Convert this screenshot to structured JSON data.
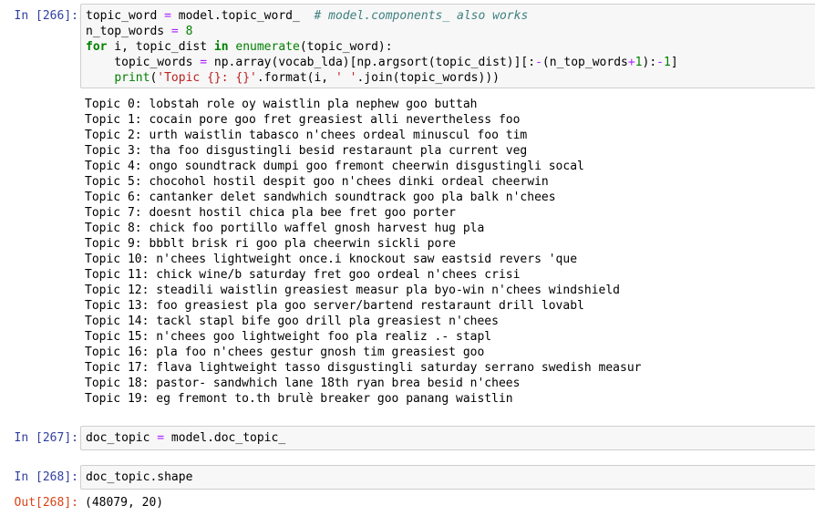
{
  "cells": [
    {
      "prompt": "In [266]:",
      "code_lines": [
        [
          {
            "t": "topic_word "
          },
          {
            "t": "=",
            "c": "op"
          },
          {
            "t": " model.topic_word_  "
          },
          {
            "t": "# model.components_ also works",
            "c": "cm"
          }
        ],
        [
          {
            "t": "n_top_words "
          },
          {
            "t": "=",
            "c": "op"
          },
          {
            "t": " "
          },
          {
            "t": "8",
            "c": "num"
          }
        ],
        [
          {
            "t": "for",
            "c": "kw"
          },
          {
            "t": " i, topic_dist "
          },
          {
            "t": "in",
            "c": "kw"
          },
          {
            "t": " "
          },
          {
            "t": "enumerate",
            "c": "bi"
          },
          {
            "t": "(topic_word):"
          }
        ],
        [
          {
            "t": "    topic_words "
          },
          {
            "t": "=",
            "c": "op"
          },
          {
            "t": " np.array(vocab_lda)[np.argsort(topic_dist)][:"
          },
          {
            "t": "-",
            "c": "op"
          },
          {
            "t": "(n_top_words"
          },
          {
            "t": "+",
            "c": "op"
          },
          {
            "t": "1",
            "c": "num"
          },
          {
            "t": "):"
          },
          {
            "t": "-",
            "c": "op"
          },
          {
            "t": "1",
            "c": "num"
          },
          {
            "t": "]"
          }
        ],
        [
          {
            "t": "    "
          },
          {
            "t": "print",
            "c": "bi"
          },
          {
            "t": "("
          },
          {
            "t": "'Topic {}: {}'",
            "c": "str"
          },
          {
            "t": ".format(i, "
          },
          {
            "t": "' '",
            "c": "str"
          },
          {
            "t": ".join(topic_words)))"
          }
        ]
      ],
      "output_lines": [
        "Topic 0: lobstah role oy waistlin pla nephew goo buttah",
        "Topic 1: cocain pore goo fret greasiest alli nevertheless foo",
        "Topic 2: urth waistlin tabasco n'chees ordeal minuscul foo tim",
        "Topic 3: tha foo disgustingli besid restaraunt pla current veg",
        "Topic 4: ongo soundtrack dumpi goo fremont cheerwin disgustingli socal",
        "Topic 5: chocohol hostil despit goo n'chees dinki ordeal cheerwin",
        "Topic 6: cantanker delet sandwhich soundtrack goo pla balk n'chees",
        "Topic 7: doesnt hostil chica pla bee fret goo porter",
        "Topic 8: chick foo portillo waffel gnosh harvest hug pla",
        "Topic 9: bbblt brisk ri goo pla cheerwin sickli pore",
        "Topic 10: n'chees lightweight once.i knockout saw eastsid revers 'que",
        "Topic 11: chick wine/b saturday fret goo ordeal n'chees crisi",
        "Topic 12: steadili waistlin greasiest measur pla byo-win n'chees windshield",
        "Topic 13: foo greasiest pla goo server/bartend restaraunt drill lovabl",
        "Topic 14: tackl stapl bife goo drill pla greasiest n'chees",
        "Topic 15: n'chees goo lightweight foo pla realiz .- stapl",
        "Topic 16: pla foo n'chees gestur gnosh tim greasiest goo",
        "Topic 17: flava lightweight tasso disgustingli saturday serrano swedish measur",
        "Topic 18: pastor- sandwhich lane 18th ryan brea besid n'chees",
        "Topic 19: eg fremont to.th brulè breaker goo panang waistlin"
      ]
    },
    {
      "prompt": "In [267]:",
      "code_lines": [
        [
          {
            "t": "doc_topic "
          },
          {
            "t": "=",
            "c": "op"
          },
          {
            "t": " model.doc_topic_"
          }
        ]
      ]
    },
    {
      "prompt": "In [268]:",
      "code_lines": [
        [
          {
            "t": "doc_topic.shape"
          }
        ]
      ],
      "out_prompt": "Out[268]:",
      "output_lines": [
        "(48079, 20)"
      ]
    }
  ]
}
